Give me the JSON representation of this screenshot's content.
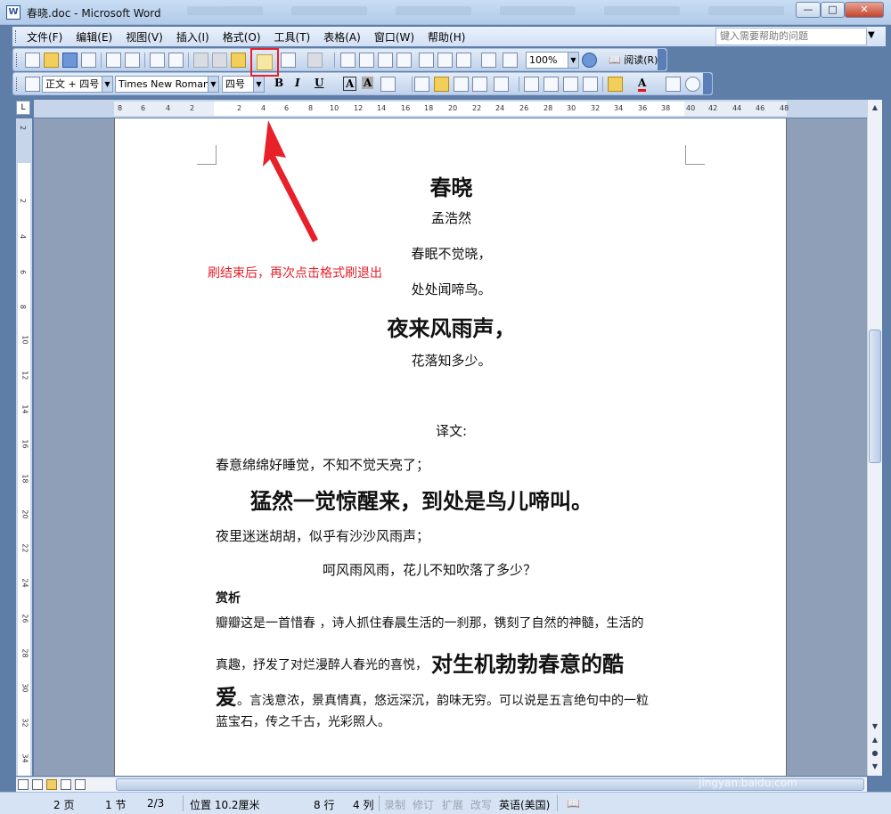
{
  "window": {
    "title": "春晓.doc - Microsoft Word",
    "app_icon": "W"
  },
  "menu": {
    "items": [
      "文件(F)",
      "编辑(E)",
      "视图(V)",
      "插入(I)",
      "格式(O)",
      "工具(T)",
      "表格(A)",
      "窗口(W)",
      "帮助(H)"
    ],
    "help_placeholder": "键入需要帮助的问题"
  },
  "toolbar": {
    "zoom": "100%",
    "read_label": "阅读(R)"
  },
  "format_toolbar": {
    "style": "正文 + 四号",
    "font": "Times New Roman",
    "size": "四号",
    "bold": "B",
    "italic": "I",
    "underline": "U",
    "char_border": "A",
    "char_shade": "A",
    "font_color": "A"
  },
  "ruler": {
    "h_ticks": [
      "8",
      "6",
      "4",
      "2",
      "2",
      "4",
      "6",
      "8",
      "10",
      "12",
      "14",
      "16",
      "18",
      "20",
      "22",
      "24",
      "26",
      "28",
      "30",
      "32",
      "34",
      "36",
      "38",
      "40",
      "42",
      "44",
      "46",
      "48"
    ],
    "v_ticks": [
      "2",
      "2",
      "4",
      "6",
      "8",
      "10",
      "12",
      "14",
      "16",
      "18",
      "20",
      "22",
      "24",
      "26",
      "28",
      "30",
      "32",
      "34"
    ]
  },
  "document": {
    "title": "春晓",
    "author": "孟浩然",
    "lines": [
      "春眠不觉晓，",
      "处处闻啼鸟。",
      "夜来风雨声，",
      "花落知多少。"
    ],
    "translation_heading": "译文:",
    "translation": [
      "春意绵绵好睡觉，不知不觉天亮了；",
      "猛然一觉惊醒来，到处是鸟儿啼叫。",
      "夜里迷迷胡胡，似乎有沙沙风雨声；",
      "呵风雨风雨，花儿不知吹落了多少？"
    ],
    "analysis_heading": "赏析",
    "analysis_p1": "瓣瓣这是一首惜春 ，诗人抓住春晨生活的一刹那，镌刻了自然的神髓，生活的",
    "analysis_p2a": "真趣，抒发了对烂漫醉人春光的喜悦，",
    "analysis_p2b": "对生机勃勃春意的酷",
    "analysis_p3a": "爱",
    "analysis_p3b": "。言浅意浓，景真情真，悠远深沉，韵味无穷。可以说是五言绝句中的一粒",
    "analysis_p4": "蓝宝石，传之千古，光彩照人。"
  },
  "annotation": {
    "text": "刷结束后，再次点击格式刷退出",
    "color": "#e8202a"
  },
  "status": {
    "page": "2 页",
    "section": "1 节",
    "page_of": "2/3",
    "position": "位置 10.2厘米",
    "line": "8 行",
    "column": "4 列",
    "rec": "录制",
    "trk": "修订",
    "ext": "扩展",
    "ovr": "改写",
    "language": "英语(美国)"
  },
  "watermark": {
    "brand": "Bai经验",
    "url": "jingyan.baidu.com"
  }
}
